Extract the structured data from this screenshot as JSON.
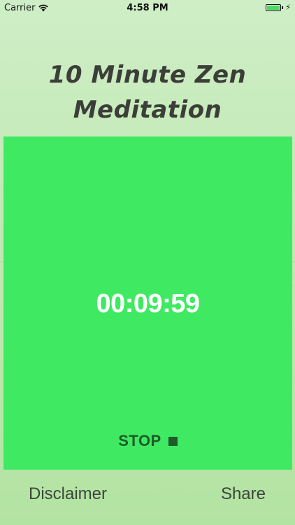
{
  "status_bar": {
    "carrier": "Carrier",
    "time": "4:58 PM",
    "battery_level": 1.0
  },
  "title": {
    "line1": "10 Minute Zen",
    "line2": "Meditation"
  },
  "timer": {
    "display": "00:09:59",
    "stop_label": "STOP"
  },
  "footer": {
    "disclaimer_label": "Disclaimer",
    "share_label": "Share"
  },
  "colors": {
    "panel": "#3fea62",
    "timer_text": "#ffffff",
    "stop_text": "#1f5a2a",
    "title_text": "#3b3f38"
  }
}
